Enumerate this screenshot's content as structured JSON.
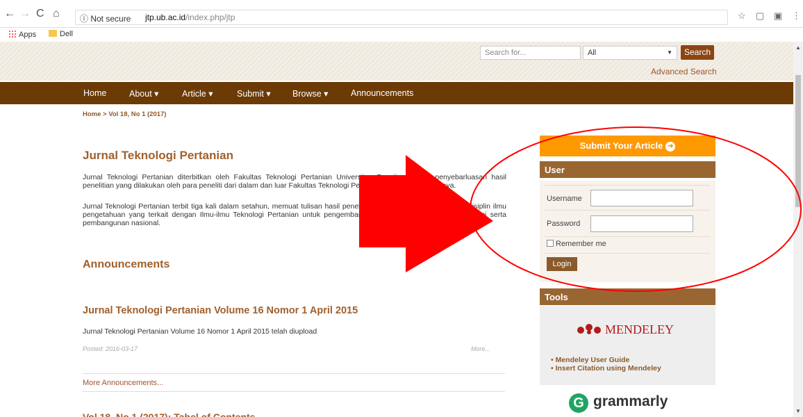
{
  "browser": {
    "nav_back": "←",
    "nav_forward": "→",
    "nav_reload": "C",
    "nav_home": "⌂",
    "security": "ⓘ Not secure",
    "url_host": "jtp.ub.ac.id",
    "url_path": "/index.php/jtp",
    "bookmarks": [
      "Apps",
      "Dell"
    ]
  },
  "header": {
    "search_placeholder": "Search for...",
    "search_scope": "All",
    "search_button": "Search",
    "advanced_search": "Advanced Search"
  },
  "menu": [
    "Home",
    "About ▾",
    "Article ▾",
    "Submit ▾",
    "Browse ▾",
    "Announcements"
  ],
  "breadcrumb": "Home > Vol 18, No 1 (2017)",
  "main": {
    "title": "Jurnal Teknologi Pertanian",
    "para1": "Jurnal Teknologi Pertanian diterbitkan oleh Fakultas Teknologi Pertanian Universitas Brawijaya untuk penyebarluasan hasil penelitian yang dilakukan oleh para peneliti dari dalam dan luar Fakultas Teknologi Pertanian Universitas Brawijaya.",
    "para2": "Jurnal Teknologi Pertanian terbit tiga kali dalam setahun, memuat tulisan hasil penelitian yang berada dalam lingkup disiplin ilmu pengetahuan yang terkait dengan Ilmu-ilmu Teknologi Pertanian untuk pengembangan ilmu pengetahuan dan teknologi serta pembangunan nasional.",
    "announcements_heading": "Announcements",
    "ann_title": "Jurnal Teknologi Pertanian Volume 16 Nomor 1 April 2015",
    "ann_body": "Jurnal Teknologi Pertanian Volume 16 Nomor 1 April 2015 telah diupload",
    "ann_posted": "Posted: 2016-03-17",
    "ann_more": "More...",
    "more_announcements": "More Announcements...",
    "next_heading": "Vol 18, No 1 (2017): Tabel of Contents"
  },
  "sidebar": {
    "submit_article": "Submit Your Article",
    "user_heading": "User",
    "username_label": "Username",
    "password_label": "Password",
    "remember_me": "Remember me",
    "login_button": "Login",
    "tools_heading": "Tools",
    "mendeley_logo_text": "MENDELEY",
    "tools_links": [
      "Mendeley User Guide",
      "Insert Citation using Mendeley"
    ],
    "grammarly_text": "grammarly"
  },
  "colors": {
    "menu_bar": "#6b3a05",
    "accent_brown": "#996632",
    "submit_orange": "#ff9900",
    "annotation_red": "#ff0000"
  }
}
